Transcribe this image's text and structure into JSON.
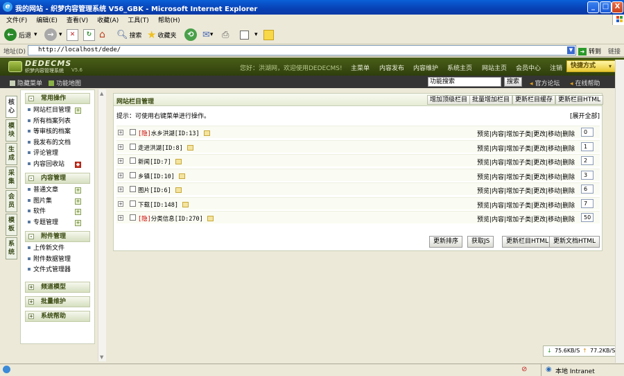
{
  "window": {
    "title": "我的网站 - 织梦内容管理系统 V56_GBK - Microsoft Internet Explorer",
    "minimize": "_",
    "maximize": "□",
    "close": "X"
  },
  "menubar": [
    "文件(F)",
    "编辑(E)",
    "查看(V)",
    "收藏(A)",
    "工具(T)",
    "帮助(H)"
  ],
  "toolbar": {
    "back": "后退",
    "search": "搜索",
    "favorites": "收藏夹"
  },
  "address": {
    "label": "地址(D)",
    "url": "http://localhost/dede/",
    "go": "转到",
    "links": "链接"
  },
  "dede_header": {
    "logo_title": "DEDECMS",
    "logo_subtitle": "织梦内容管理系统",
    "version": "V5.6",
    "welcome": "您好：洪湖网，欢迎使用DEDECMS!",
    "nav": [
      "主菜单",
      "内容发布",
      "内容维护",
      "系统主页",
      "网站主页",
      "会员中心",
      "注销"
    ],
    "quick": "快捷方式"
  },
  "darkbar": {
    "hide_menu": "隐藏菜单",
    "func_map": "功能地图",
    "search_placeholder": "功能搜索",
    "search_btn": "搜索",
    "forum": "官方论坛",
    "help": "在线帮助"
  },
  "vtabs": [
    "核心",
    "模块",
    "生成",
    "采集",
    "会员",
    "模板",
    "系统"
  ],
  "leftmenu": {
    "sections": [
      {
        "title": "常用操作",
        "items": [
          {
            "label": "网站栏目管理",
            "add": true
          },
          {
            "label": "所有档案列表",
            "add": false
          },
          {
            "label": "等审核的档案",
            "add": false
          },
          {
            "label": "我发布的文档",
            "add": false
          },
          {
            "label": "评论管理",
            "add": false
          },
          {
            "label": "内容回收站",
            "add": false,
            "shield": true
          }
        ]
      },
      {
        "title": "内容管理",
        "items": [
          {
            "label": "普通文章",
            "add": true
          },
          {
            "label": "图片集",
            "add": true
          },
          {
            "label": "软件",
            "add": true
          },
          {
            "label": "专题管理",
            "add": true
          }
        ]
      },
      {
        "title": "附件管理",
        "items": [
          {
            "label": "上传新文件",
            "add": false
          },
          {
            "label": "附件数据管理",
            "add": false
          },
          {
            "label": "文件式管理器",
            "add": false
          }
        ]
      },
      {
        "title": "频道模型",
        "items": []
      },
      {
        "title": "批量维护",
        "items": []
      },
      {
        "title": "系统帮助",
        "items": []
      }
    ]
  },
  "main": {
    "title": "网站栏目管理",
    "head_buttons": [
      "增加顶级栏目",
      "批量增加栏目",
      "更新栏目缓存",
      "更新栏目HTML"
    ],
    "tip": "提示：可使用右键菜单进行操作。",
    "expand_all": "[展开全部]",
    "actions": "预览|内容|增加子类|更改|移动|删除",
    "categories": [
      {
        "hidden": "[隐]",
        "name": "水乡洪湖[ID:13]",
        "order": "0"
      },
      {
        "hidden": "",
        "name": "走进洪湖[ID:8]",
        "order": "1"
      },
      {
        "hidden": "",
        "name": "新闻[ID:7]",
        "order": "2"
      },
      {
        "hidden": "",
        "name": "乡镇[ID:10]",
        "order": "3"
      },
      {
        "hidden": "",
        "name": "图片[ID:6]",
        "order": "6"
      },
      {
        "hidden": "",
        "name": "下载[ID:148]",
        "order": "7"
      },
      {
        "hidden": "[隐]",
        "name": "分类信息[ID:270]",
        "order": "50"
      }
    ],
    "bottom_buttons": [
      "更新排序",
      "获取JS",
      "更新栏目HTML",
      "更新文档HTML"
    ]
  },
  "speed": {
    "down": "75.6KB/S",
    "up": "77.2KB/S"
  },
  "status": {
    "zone": "本地 Intranet"
  }
}
